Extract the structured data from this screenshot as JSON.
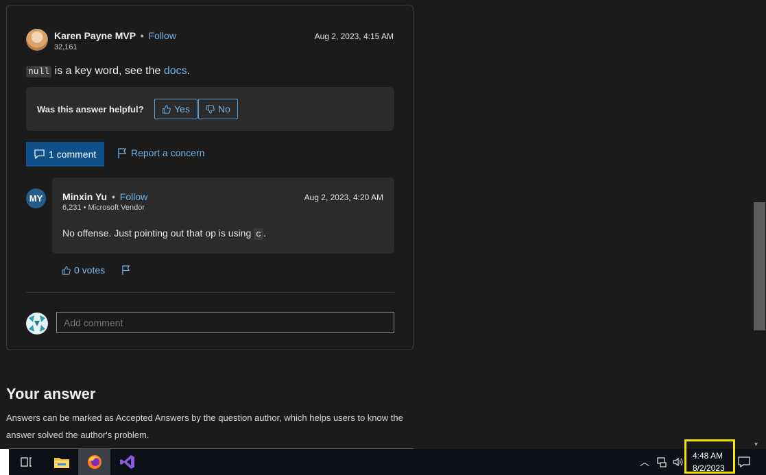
{
  "answer": {
    "author": "Karen Payne MVP",
    "separator": "•",
    "follow": "Follow",
    "reputation": "32,161",
    "timestamp": "Aug 2, 2023, 4:15 AM",
    "code": "null",
    "text_before": " is a key word, see the ",
    "link": "docs",
    "text_after": "."
  },
  "helpful": {
    "label": "Was this answer helpful?",
    "yes": "Yes",
    "no": "No"
  },
  "actions": {
    "comment_button": "1 comment",
    "report": "Report a concern"
  },
  "comment": {
    "initials": "MY",
    "author": "Minxin Yu",
    "separator": "•",
    "follow": "Follow",
    "meta": "6,231 • Microsoft Vendor",
    "timestamp": "Aug 2, 2023, 4:20 AM",
    "text_before": "No offense. Just pointing out that op is using ",
    "code": "c",
    "text_after": ".",
    "votes": "0 votes"
  },
  "add_comment": {
    "placeholder": "Add comment"
  },
  "your_answer": {
    "heading": "Your answer",
    "help": "Answers can be marked as Accepted Answers by the question author, which helps users to know the answer solved the author's problem."
  },
  "taskbar": {
    "icons": [
      "task-view-icon",
      "file-explorer-icon",
      "firefox-icon",
      "visual-studio-icon"
    ],
    "tray_icons": [
      "chevron-up-icon",
      "network-icon",
      "volume-icon",
      "notification-icon"
    ],
    "time": "4:48 AM",
    "date": "8/2/2023",
    "highlight_color": "#f5e400"
  },
  "colors": {
    "background": "#1b1b1b",
    "link": "#75b6e7",
    "primary_button": "#0f4f8a",
    "panel": "#2b2b2b"
  }
}
